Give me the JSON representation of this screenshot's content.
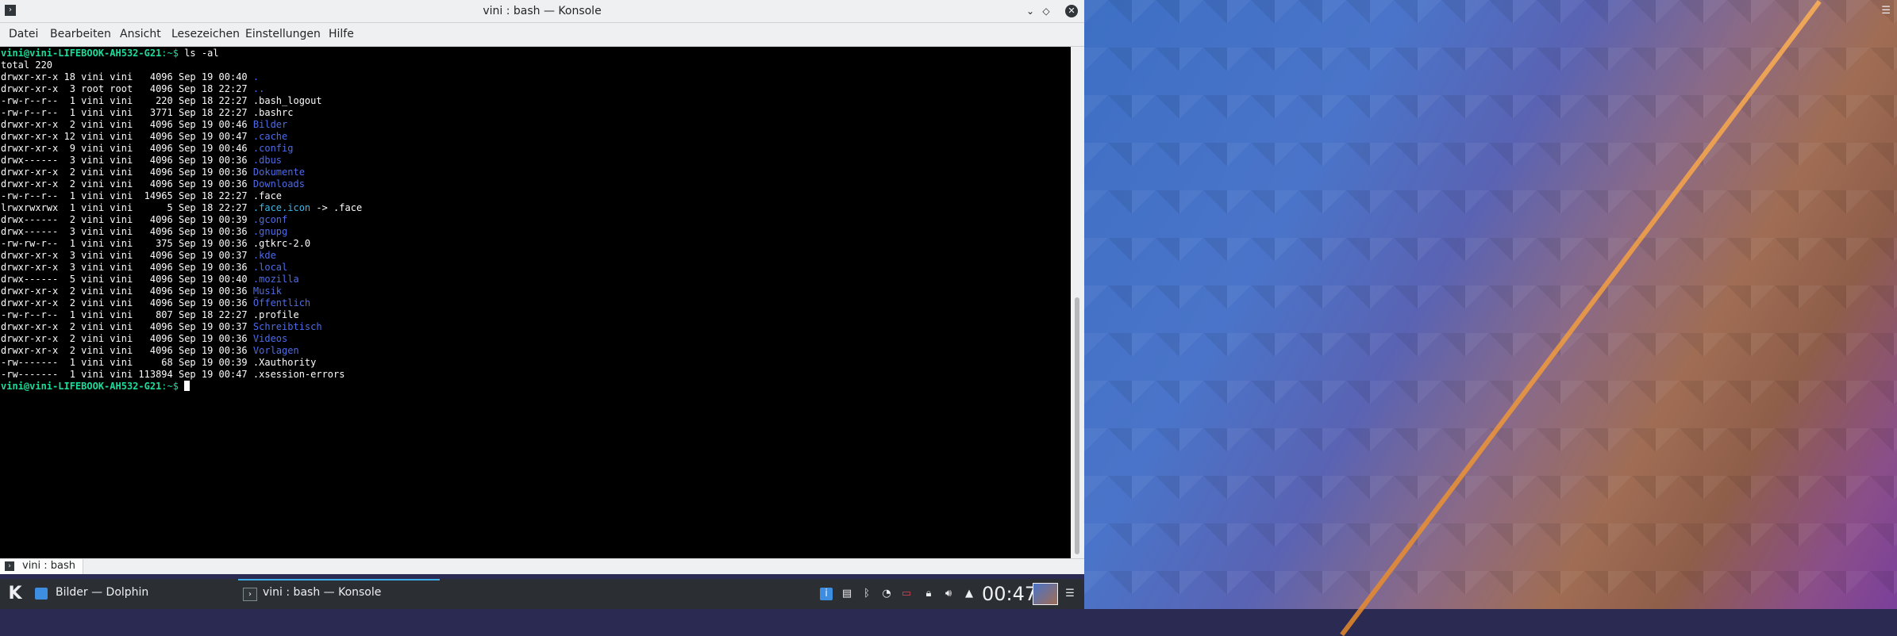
{
  "window": {
    "title": "vini : bash — Konsole",
    "buttons": {
      "minimize": "⌄",
      "keep_above": "◇",
      "close": "✕"
    }
  },
  "menubar": [
    "Datei",
    "Bearbeiten",
    "Ansicht",
    "Lesezeichen",
    "Einstellungen",
    "Hilfe"
  ],
  "terminal": {
    "prompt_user": "vini@vini-LIFEBOOK-AH532-G21",
    "prompt_path": ":~$",
    "command": " ls -al",
    "total": "total 220",
    "entries": [
      {
        "meta": "drwxr-xr-x 18 vini vini   4096 Sep 19 00:40 ",
        "name": ".",
        "kind": "dir"
      },
      {
        "meta": "drwxr-xr-x  3 root root   4096 Sep 18 22:27 ",
        "name": "..",
        "kind": "dir"
      },
      {
        "meta": "-rw-r--r--  1 vini vini    220 Sep 18 22:27 ",
        "name": ".bash_logout",
        "kind": "file"
      },
      {
        "meta": "-rw-r--r--  1 vini vini   3771 Sep 18 22:27 ",
        "name": ".bashrc",
        "kind": "file"
      },
      {
        "meta": "drwxr-xr-x  2 vini vini   4096 Sep 19 00:46 ",
        "name": "Bilder",
        "kind": "dir"
      },
      {
        "meta": "drwxr-xr-x 12 vini vini   4096 Sep 19 00:47 ",
        "name": ".cache",
        "kind": "dir"
      },
      {
        "meta": "drwxr-xr-x  9 vini vini   4096 Sep 19 00:46 ",
        "name": ".config",
        "kind": "dir"
      },
      {
        "meta": "drwx------  3 vini vini   4096 Sep 19 00:36 ",
        "name": ".dbus",
        "kind": "dir"
      },
      {
        "meta": "drwxr-xr-x  2 vini vini   4096 Sep 19 00:36 ",
        "name": "Dokumente",
        "kind": "dir"
      },
      {
        "meta": "drwxr-xr-x  2 vini vini   4096 Sep 19 00:36 ",
        "name": "Downloads",
        "kind": "dir"
      },
      {
        "meta": "-rw-r--r--  1 vini vini  14965 Sep 18 22:27 ",
        "name": ".face",
        "kind": "file"
      },
      {
        "meta": "lrwxrwxrwx  1 vini vini      5 Sep 18 22:27 ",
        "name": ".face.icon",
        "kind": "link",
        "target": " -> .face"
      },
      {
        "meta": "drwx------  2 vini vini   4096 Sep 19 00:39 ",
        "name": ".gconf",
        "kind": "dir"
      },
      {
        "meta": "drwx------  3 vini vini   4096 Sep 19 00:36 ",
        "name": ".gnupg",
        "kind": "dir"
      },
      {
        "meta": "-rw-rw-r--  1 vini vini    375 Sep 19 00:36 ",
        "name": ".gtkrc-2.0",
        "kind": "file"
      },
      {
        "meta": "drwxr-xr-x  3 vini vini   4096 Sep 19 00:37 ",
        "name": ".kde",
        "kind": "dir"
      },
      {
        "meta": "drwxr-xr-x  3 vini vini   4096 Sep 19 00:36 ",
        "name": ".local",
        "kind": "dir"
      },
      {
        "meta": "drwx------  5 vini vini   4096 Sep 19 00:40 ",
        "name": ".mozilla",
        "kind": "dir"
      },
      {
        "meta": "drwxr-xr-x  2 vini vini   4096 Sep 19 00:36 ",
        "name": "Musik",
        "kind": "dir"
      },
      {
        "meta": "drwxr-xr-x  2 vini vini   4096 Sep 19 00:36 ",
        "name": "Öffentlich",
        "kind": "dir"
      },
      {
        "meta": "-rw-r--r--  1 vini vini    807 Sep 18 22:27 ",
        "name": ".profile",
        "kind": "file"
      },
      {
        "meta": "drwxr-xr-x  2 vini vini   4096 Sep 19 00:37 ",
        "name": "Schreibtisch",
        "kind": "dir"
      },
      {
        "meta": "drwxr-xr-x  2 vini vini   4096 Sep 19 00:36 ",
        "name": "Videos",
        "kind": "dir"
      },
      {
        "meta": "drwxr-xr-x  2 vini vini   4096 Sep 19 00:36 ",
        "name": "Vorlagen",
        "kind": "dir"
      },
      {
        "meta": "-rw-------  1 vini vini     68 Sep 19 00:39 ",
        "name": ".Xauthority",
        "kind": "file"
      },
      {
        "meta": "-rw-------  1 vini vini 113894 Sep 19 00:47 ",
        "name": ".xsession-errors",
        "kind": "file"
      }
    ]
  },
  "tab": {
    "label": "vini : bash"
  },
  "taskbar": {
    "tasks": [
      {
        "label": "Bilder — Dolphin",
        "icon": "folder-icon",
        "active": false
      },
      {
        "label": "vini : bash — Konsole",
        "icon": "terminal-icon",
        "active": true
      }
    ],
    "clock": "00:47"
  },
  "colors": {
    "prompt": "#1cdc9a",
    "directory": "#4e6be8",
    "link": "#3fb8e8",
    "accent": "#3daee9"
  }
}
